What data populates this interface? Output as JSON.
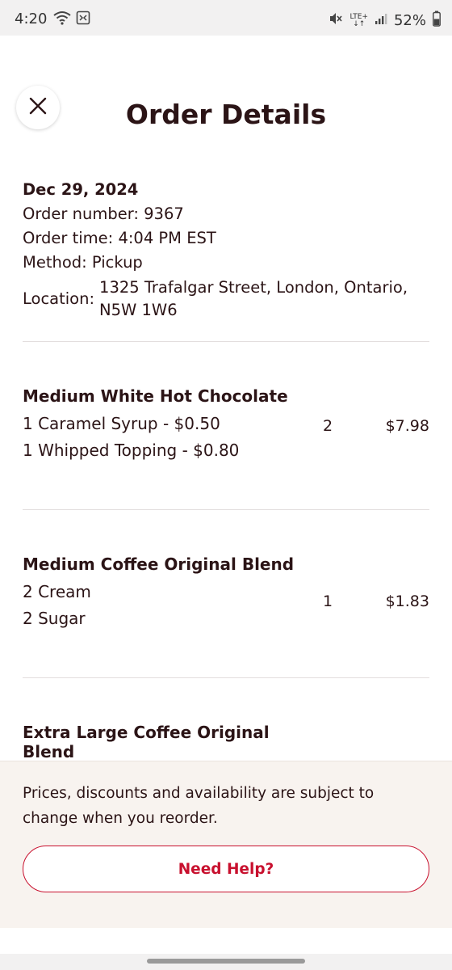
{
  "status_bar": {
    "time": "4:20",
    "battery": "52%",
    "network": "LTE+",
    "icons": [
      "wifi-icon",
      "data-saver-icon",
      "mute-icon",
      "signal-icon",
      "battery-icon"
    ]
  },
  "header": {
    "title": "Order Details",
    "close_icon": "close-icon"
  },
  "order": {
    "date": "Dec 29, 2024",
    "number": "Order number: 9367",
    "time": "Order time: 4:04 PM EST",
    "method": "Method:  Pickup",
    "location_label": "Location:",
    "location_value": "1325 Trafalgar Street, London, Ontario, N5W 1W6"
  },
  "items": [
    {
      "name": "Medium White Hot Chocolate",
      "mods": [
        "1 Caramel Syrup - $0.50",
        "1 Whipped Topping - $0.80"
      ],
      "qty": "2",
      "price": "$7.98"
    },
    {
      "name": "Medium Coffee Original Blend",
      "mods": [
        "2 Cream",
        "2 Sugar"
      ],
      "qty": "1",
      "price": "$1.83"
    },
    {
      "name": "Extra Large Coffee Original Blend",
      "mods": [],
      "qty": "",
      "price": ""
    }
  ],
  "footer": {
    "note": "Prices, discounts and availability are subject to change when you reorder.",
    "help_label": "Need Help?"
  },
  "colors": {
    "brand_red": "#c8102e",
    "text_dark": "#2b1416",
    "footer_bg": "#f8f3ef"
  }
}
